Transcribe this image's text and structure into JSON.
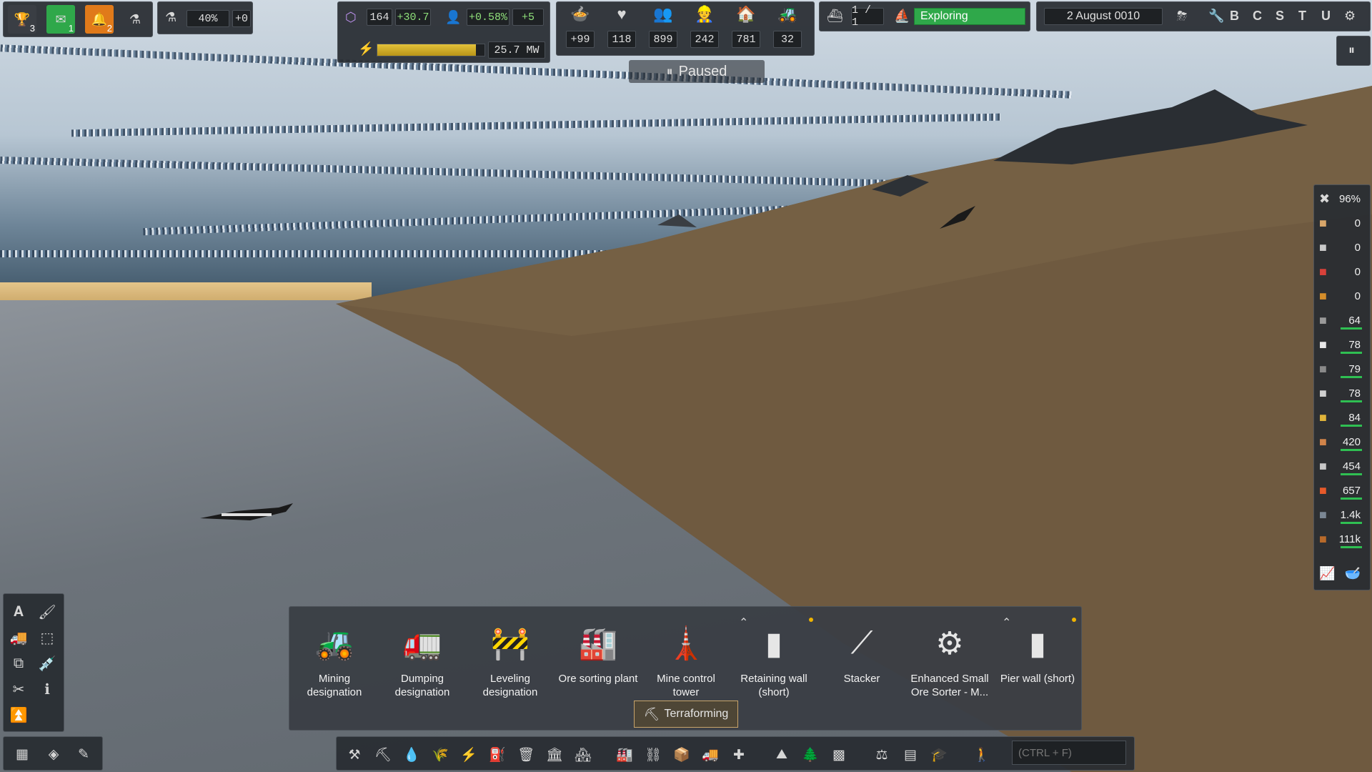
{
  "top_left": {
    "achievements_count": "3",
    "messages_count": "1",
    "notifications_count": "2",
    "research_percent": "40%",
    "research_delta": "+0"
  },
  "population": {
    "unity": "164",
    "unity_delta": "+30.7",
    "growth": "+0.58%",
    "growth_delta": "+5"
  },
  "power": {
    "value": "25.7 MW",
    "fill_fraction": 0.92
  },
  "stats": [
    {
      "icon": "food-icon",
      "value": "+99"
    },
    {
      "icon": "health-icon",
      "value": "118"
    },
    {
      "icon": "people-icon",
      "value": "899"
    },
    {
      "icon": "workers-icon",
      "value": "242"
    },
    {
      "icon": "housing-icon",
      "value": "781"
    },
    {
      "icon": "vehicles-icon",
      "value": "32"
    }
  ],
  "ships": {
    "count": "1 / 1",
    "status": "Exploring"
  },
  "date": "2 August 0010",
  "top_right_letters": [
    "B",
    "C",
    "S",
    "T",
    "U"
  ],
  "pause_label": "Paused",
  "maintenance_percent": "96%",
  "resources": [
    {
      "icon": "resource-1-icon",
      "value": "0",
      "color": "#d8a66a"
    },
    {
      "icon": "resource-2-icon",
      "value": "0",
      "color": "#c9c9c9"
    },
    {
      "icon": "resource-3-icon",
      "value": "0",
      "color": "#d8413a"
    },
    {
      "icon": "resource-4-icon",
      "value": "0",
      "color": "#d48d2a"
    },
    {
      "icon": "resource-5-icon",
      "value": "64",
      "color": "#9a9a9a"
    },
    {
      "icon": "resource-6-icon",
      "value": "78",
      "color": "#e8e8e8"
    },
    {
      "icon": "resource-7-icon",
      "value": "79",
      "color": "#8a8a8a"
    },
    {
      "icon": "resource-8-icon",
      "value": "78",
      "color": "#d0d0d0"
    },
    {
      "icon": "resource-9-icon",
      "value": "84",
      "color": "#e0b43a"
    },
    {
      "icon": "resource-10-icon",
      "value": "420",
      "color": "#d1844a"
    },
    {
      "icon": "resource-11-icon",
      "value": "454",
      "color": "#c8c8c8"
    },
    {
      "icon": "resource-12-icon",
      "value": "657",
      "color": "#e85a2a"
    },
    {
      "icon": "resource-13-icon",
      "value": "1.4k",
      "color": "#7b8794"
    },
    {
      "icon": "resource-14-icon",
      "value": "111k",
      "color": "#b86a2a"
    }
  ],
  "build_menu": {
    "category": "Terraforming",
    "items": [
      {
        "label": "Mining designation"
      },
      {
        "label": "Dumping designation"
      },
      {
        "label": "Leveling designation"
      },
      {
        "label": "Ore sorting plant"
      },
      {
        "label": "Mine control tower"
      },
      {
        "label": "Retaining wall (short)"
      },
      {
        "label": "Stacker"
      },
      {
        "label": "Enhanced Small Ore Sorter - M..."
      },
      {
        "label": "Pier wall (short)"
      }
    ]
  },
  "search": {
    "placeholder": "(CTRL + F)"
  },
  "colors": {
    "accent_green": "#2fa84a",
    "panel_bg": "#282c31",
    "badge_orange": "#e07a1a"
  }
}
